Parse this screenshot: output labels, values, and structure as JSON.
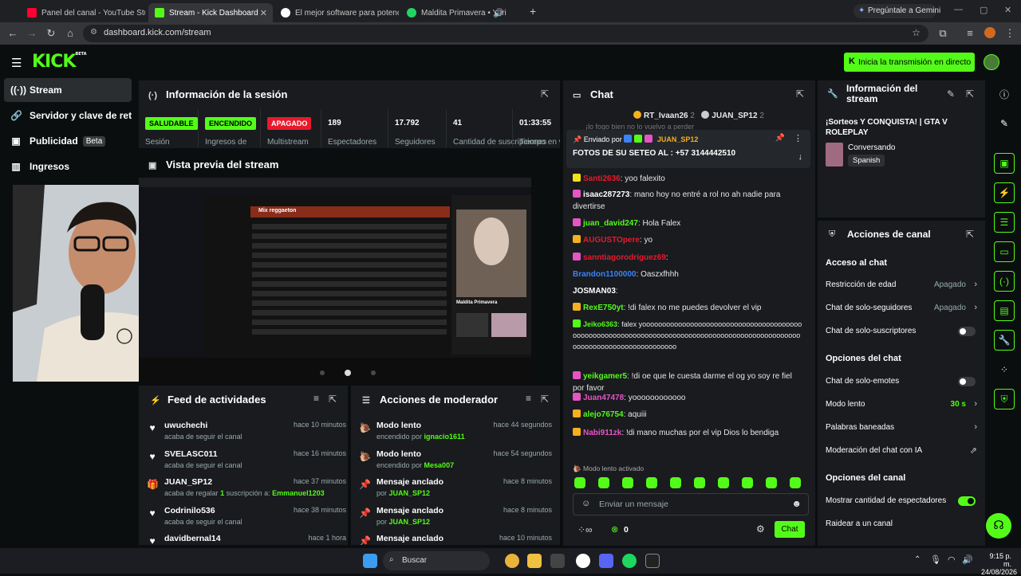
{
  "browser": {
    "tabs": [
      {
        "title": "Panel del canal - YouTube Studio",
        "favicon": "youtube-icon",
        "color": "#ff0033"
      },
      {
        "title": "Stream - Kick Dashboard",
        "favicon": "kick-icon",
        "color": "#53fc18",
        "active": true
      },
      {
        "title": "El mejor software para potencia",
        "favicon": "obs-icon",
        "color": "#ffffff"
      },
      {
        "title": "Maldita Primavera • Yuri",
        "favicon": "spotify-icon",
        "color": "#1ed760"
      }
    ],
    "gemini_label": "Pregúntale a Gemini",
    "url": "dashboard.kick.com/stream"
  },
  "header": {
    "logo": "KICK",
    "logo_tag": "BETA",
    "go_live_label": "Inicia la transmisión en directo"
  },
  "sidebar": {
    "items": [
      {
        "label": "Stream",
        "icon": "broadcast-icon",
        "active": true
      },
      {
        "label": "Servidor y clave de retransmisión",
        "icon": "link-icon"
      },
      {
        "label": "Publicidad",
        "icon": "ad-icon",
        "badge": "Beta"
      },
      {
        "label": "Ingresos",
        "icon": "chart-icon"
      }
    ]
  },
  "session": {
    "title": "Información de la sesión",
    "stats": [
      {
        "value": "SALUDABLE",
        "label": "Sesión",
        "kind": "badge",
        "bg": "#53fc18",
        "fg": "#000000"
      },
      {
        "value": "ENCENDIDO",
        "label": "Ingresos de",
        "kind": "badge",
        "bg": "#53fc18",
        "fg": "#000000"
      },
      {
        "value": "APAGADO",
        "label": "Multistream",
        "kind": "badge",
        "bg": "#e8192c",
        "fg": "#ffffff"
      },
      {
        "value": "189",
        "label": "Espectadores",
        "kind": "num"
      },
      {
        "value": "17.792",
        "label": "Seguidores",
        "kind": "num"
      },
      {
        "value": "41",
        "label": "Cantidad de suscripciones",
        "kind": "num"
      },
      {
        "value": "01:33:55",
        "label": "Tiempo en vivo",
        "kind": "num"
      }
    ]
  },
  "preview": {
    "title": "Vista previa del stream",
    "playlist_title": "Mix reggaeton",
    "song": "Maldita Primavera"
  },
  "feed": {
    "title": "Feed de actividades",
    "items": [
      {
        "name": "uwuchechi",
        "action": "acaba de seguir el canal",
        "time": "hace 10 minutos",
        "icon": "heart-icon"
      },
      {
        "name": "SVELASC011",
        "action": "acaba de seguir el canal",
        "time": "hace 16 minutos",
        "icon": "heart-icon"
      },
      {
        "name": "JUAN_SP12",
        "action": "acaba de regalar ",
        "count": "1",
        "action2": " suscripción a: ",
        "target": "Emmanuel1203",
        "time": "hace 37 minutos",
        "icon": "gift-icon"
      },
      {
        "name": "Codrinilo536",
        "action": "acaba de seguir el canal",
        "time": "hace 38 minutos",
        "icon": "heart-icon"
      },
      {
        "name": "davidbernal14",
        "action": "",
        "time": "hace 1 hora",
        "icon": "heart-icon"
      }
    ]
  },
  "mod": {
    "title": "Acciones de moderador",
    "items": [
      {
        "name": "Modo lento",
        "prefix": "encendido por ",
        "by": "ignacio1611",
        "time": "hace 44 segundos",
        "icon": "snail-icon"
      },
      {
        "name": "Modo lento",
        "prefix": "encendido por ",
        "by": "Mesa007",
        "time": "hace 54 segundos",
        "icon": "snail-icon"
      },
      {
        "name": "Mensaje anclado",
        "prefix": "por ",
        "by": "JUAN_SP12",
        "time": "hace 8 minutos",
        "icon": "pin-icon"
      },
      {
        "name": "Mensaje anclado",
        "prefix": "por ",
        "by": "JUAN_SP12",
        "time": "hace 8 minutos",
        "icon": "pin-icon"
      },
      {
        "name": "Mensaje anclado",
        "prefix": "",
        "by": "",
        "time": "hace 10 minutos",
        "icon": "pin-icon"
      }
    ]
  },
  "chat": {
    "title": "Chat",
    "top_gifters": [
      {
        "name": "RT_Ivaan26",
        "count": "2",
        "color": "#f5b01b"
      },
      {
        "name": "JUAN_SP12",
        "count": "2",
        "color": "#cccccc"
      }
    ],
    "pinned": {
      "sent_by_label": "Enviado por",
      "sender": "JUAN_SP12",
      "text": "FOTOS DE SU SETEO AL : +57 3144442510",
      "partial_behind": "¡lo fogo bien no lo vuelvo a perder"
    },
    "messages": [
      {
        "user": "Santi2636",
        "color": "#e8192c",
        "text": "yoo falexito",
        "badge": "#f5e11b"
      },
      {
        "user": "isaac287273",
        "color": "#ffffff",
        "text": "mano hoy no entré a rol no ah nadie para divertirse",
        "badge": "#e754c4"
      },
      {
        "user": "juan_david247",
        "color": "#53fc18",
        "text": "Hola Falex",
        "badge": "#e754c4"
      },
      {
        "user": "AUGUSTOpere",
        "color": "#e8192c",
        "text": "yo",
        "badge": "#f5b01b"
      },
      {
        "user": "sanntiagorodriguez69",
        "color": "#e8192c",
        "text": "",
        "badge": "#e754c4"
      },
      {
        "user": "Brandon1100000",
        "color": "#3b82f6",
        "text": "Oaszxfhhh",
        "badge": ""
      },
      {
        "user": "JOSMAN03",
        "color": "#ffffff",
        "text": "",
        "badge": ""
      },
      {
        "user": "RexE750yt",
        "color": "#53fc18",
        "text": "!di falex no me puedes devolver el vip",
        "badge": "#f5b01b"
      },
      {
        "user": "Jeiko6363",
        "color": "#53fc18",
        "text": "falex yooooooooooooooooooooooooooooooooooooooooooooooooooooooooooooooooooooooooooooooooooooooooooooooooooooooooooooooooooooooooooo",
        "badge": "#53fc18"
      },
      {
        "user": "yeikgamer5",
        "color": "#53fc18",
        "text": "!di oe que le cuesta darme el og yo soy re fiel por favor",
        "badge": "#e754c4"
      },
      {
        "user": "Juan47478",
        "color": "#e754c4",
        "text": "yoooooooooooo",
        "badge": "#e754c4"
      },
      {
        "user": "alejo76754",
        "color": "#53fc18",
        "text": "aquiii",
        "badge": "#f5b01b"
      },
      {
        "user": "Nabi911zk",
        "color": "#e754c4",
        "text": "!di mano muchas por el vip Dios lo bendiga",
        "badge": "#f5b01b"
      }
    ],
    "slow_mode_note": "Modo lento activado",
    "input_placeholder": "Enviar un mensaje",
    "points": "0",
    "send_label": "Chat"
  },
  "stream_info": {
    "title": "Información del stream",
    "stream_title": "¡Sorteos Y CONQUISTA! | GTA V ROLEPLAY",
    "category": "Conversando",
    "language": "Spanish"
  },
  "channel_actions": {
    "title": "Acciones de canal",
    "sections": [
      {
        "heading": "Acceso al chat",
        "rows": [
          {
            "label": "Restricción de edad",
            "value": "Apagado",
            "type": "chevron"
          },
          {
            "label": "Chat de solo-seguidores",
            "value": "Apagado",
            "type": "chevron"
          },
          {
            "label": "Chat de solo-suscriptores",
            "type": "toggle",
            "on": false
          }
        ]
      },
      {
        "heading": "Opciones del chat",
        "rows": [
          {
            "label": "Chat de solo-emotes",
            "type": "toggle",
            "on": false
          },
          {
            "label": "Modo lento",
            "value": "30 s",
            "type": "chevron",
            "accent": true
          },
          {
            "label": "Palabras baneadas",
            "type": "chevron"
          },
          {
            "label": "Moderación del chat con IA",
            "type": "external"
          }
        ]
      },
      {
        "heading": "Opciones del canal",
        "rows": [
          {
            "label": "Mostrar cantidad de espectadores",
            "type": "toggle",
            "on": true
          },
          {
            "label": "Raidear a un canal",
            "type": "none"
          }
        ]
      }
    ]
  },
  "taskbar": {
    "search_placeholder": "Buscar",
    "time": "9:15 p. m.",
    "date": "24/08/2026"
  },
  "colors": {
    "accent": "#53fc18",
    "panel": "#191b1f",
    "background": "#0b0e0f"
  }
}
